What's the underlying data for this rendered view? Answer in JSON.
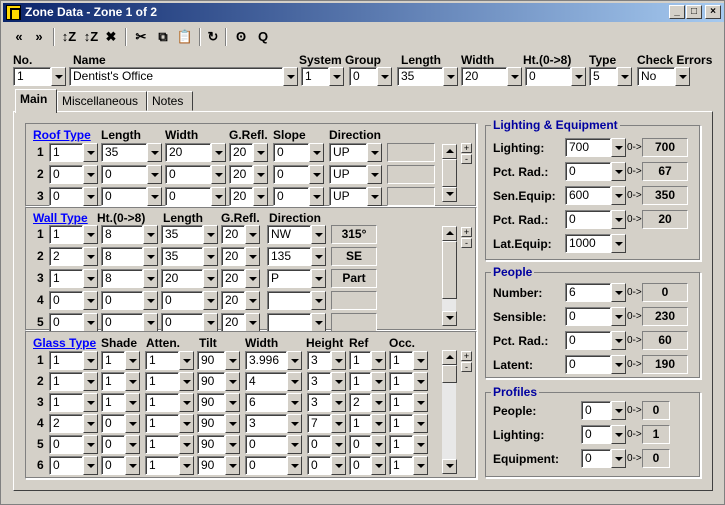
{
  "title": "Zone Data - Zone 1 of 2",
  "window_buttons": {
    "minimize": "_",
    "maximize": "□",
    "close": "×"
  },
  "toolbar": [
    "«",
    "»",
    "↕Z",
    "↕Z",
    "✖",
    "✂",
    "⧉",
    "📋",
    "↻",
    "ʘ",
    "Q"
  ],
  "header": {
    "labels": [
      "No.",
      "Name",
      "System",
      "Group",
      "Length",
      "Width",
      "Ht.(0->8)",
      "Type",
      "Check Errors"
    ],
    "values": {
      "no": "1",
      "name": "Dentist's Office",
      "system": "1",
      "group": "0",
      "length": "35",
      "width": "20",
      "ht": "0",
      "type": "5",
      "check_errors": "No"
    }
  },
  "tabs": [
    "Main",
    "Miscellaneous",
    "Notes"
  ],
  "roof": {
    "label": "Roof Type",
    "headers": [
      "Length",
      "Width",
      "G.Refl.",
      "Slope",
      "Direction"
    ],
    "rows": [
      {
        "n": "1",
        "type": "1",
        "length": "35",
        "width": "20",
        "grefl": "20",
        "slope": "0",
        "dir": "UP",
        "comp": ""
      },
      {
        "n": "2",
        "type": "0",
        "length": "0",
        "width": "0",
        "grefl": "20",
        "slope": "0",
        "dir": "UP",
        "comp": ""
      },
      {
        "n": "3",
        "type": "0",
        "length": "0",
        "width": "0",
        "grefl": "20",
        "slope": "0",
        "dir": "UP",
        "comp": ""
      }
    ]
  },
  "wall": {
    "label": "Wall Type",
    "headers": [
      "Ht.(0->8)",
      "Length",
      "G.Refl.",
      "Direction"
    ],
    "rows": [
      {
        "n": "1",
        "type": "1",
        "ht": "8",
        "length": "35",
        "grefl": "20",
        "dir": "NW",
        "comp": "315°"
      },
      {
        "n": "2",
        "type": "2",
        "ht": "8",
        "length": "35",
        "grefl": "20",
        "dir": "135",
        "comp": "SE"
      },
      {
        "n": "3",
        "type": "1",
        "ht": "8",
        "length": "20",
        "grefl": "20",
        "dir": "P",
        "comp": "Part"
      },
      {
        "n": "4",
        "type": "0",
        "ht": "0",
        "length": "0",
        "grefl": "20",
        "dir": "",
        "comp": ""
      },
      {
        "n": "5",
        "type": "0",
        "ht": "0",
        "length": "0",
        "grefl": "20",
        "dir": "",
        "comp": ""
      }
    ]
  },
  "glass": {
    "label": "Glass Type",
    "headers": [
      "Shade",
      "Atten.",
      "Tilt",
      "Width",
      "Height",
      "Ref",
      "Occ."
    ],
    "rows": [
      {
        "n": "1",
        "type": "1",
        "shade": "1",
        "atten": "1",
        "tilt": "90",
        "width": "3.996",
        "height": "3",
        "ref": "1",
        "occ": "1"
      },
      {
        "n": "2",
        "type": "1",
        "shade": "1",
        "atten": "1",
        "tilt": "90",
        "width": "4",
        "height": "3",
        "ref": "1",
        "occ": "1"
      },
      {
        "n": "3",
        "type": "1",
        "shade": "1",
        "atten": "1",
        "tilt": "90",
        "width": "6",
        "height": "3",
        "ref": "2",
        "occ": "1"
      },
      {
        "n": "4",
        "type": "2",
        "shade": "0",
        "atten": "1",
        "tilt": "90",
        "width": "3",
        "height": "7",
        "ref": "1",
        "occ": "1"
      },
      {
        "n": "5",
        "type": "0",
        "shade": "0",
        "atten": "1",
        "tilt": "90",
        "width": "0",
        "height": "0",
        "ref": "0",
        "occ": "1"
      },
      {
        "n": "6",
        "type": "0",
        "shade": "0",
        "atten": "1",
        "tilt": "90",
        "width": "0",
        "height": "0",
        "ref": "0",
        "occ": "1"
      }
    ]
  },
  "lighting": {
    "title": "Lighting & Equipment",
    "rows": [
      {
        "label": "Lighting:",
        "value": "700",
        "arrow": "0->",
        "result": "700"
      },
      {
        "label": "Pct. Rad.:",
        "value": "0",
        "arrow": "0->",
        "result": "67"
      },
      {
        "label": "Sen.Equip:",
        "value": "600",
        "arrow": "0->",
        "result": "350"
      },
      {
        "label": "Pct. Rad.:",
        "value": "0",
        "arrow": "0->",
        "result": "20"
      },
      {
        "label": "Lat.Equip:",
        "value": "1000",
        "arrow": "",
        "result": ""
      }
    ]
  },
  "people": {
    "title": "People",
    "rows": [
      {
        "label": "Number:",
        "value": "6",
        "arrow": "0->",
        "result": "0"
      },
      {
        "label": "Sensible:",
        "value": "0",
        "arrow": "0->",
        "result": "230"
      },
      {
        "label": "Pct. Rad.:",
        "value": "0",
        "arrow": "0->",
        "result": "60"
      },
      {
        "label": "Latent:",
        "value": "0",
        "arrow": "0->",
        "result": "190"
      }
    ]
  },
  "profiles": {
    "title": "Profiles",
    "rows": [
      {
        "label": "People:",
        "value": "0",
        "arrow": "0->",
        "result": "0"
      },
      {
        "label": "Lighting:",
        "value": "0",
        "arrow": "0->",
        "result": "1"
      },
      {
        "label": "Equipment:",
        "value": "0",
        "arrow": "0->",
        "result": "0"
      }
    ]
  },
  "spinner": {
    "plus": "+",
    "minus": "-"
  }
}
